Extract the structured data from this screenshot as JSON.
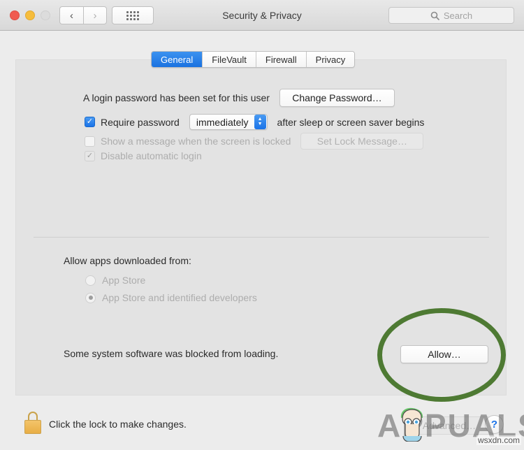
{
  "window": {
    "title": "Security & Privacy",
    "traffic_lights": [
      "close",
      "minimize",
      "zoom"
    ],
    "nav": {
      "back": "‹",
      "forward": "›",
      "grid": "show-all-grid"
    },
    "search": {
      "placeholder": "Search",
      "value": "",
      "icon": "search-icon"
    }
  },
  "tabs": [
    {
      "label": "General",
      "active": true
    },
    {
      "label": "FileVault",
      "active": false
    },
    {
      "label": "Firewall",
      "active": false
    },
    {
      "label": "Privacy",
      "active": false
    }
  ],
  "general": {
    "password_status": "A login password has been set for this user",
    "change_password_button": "Change Password…",
    "require_password": {
      "label": "Require password",
      "checked": true,
      "delay_value": "immediately",
      "suffix": "after sleep or screen saver begins"
    },
    "lock_message": {
      "label": "Show a message when the screen is locked",
      "checked": false,
      "button": "Set Lock Message…",
      "disabled": true
    },
    "disable_auto_login": {
      "label": "Disable automatic login",
      "checked": true,
      "disabled": true
    },
    "allow_apps": {
      "heading": "Allow apps downloaded from:",
      "options": [
        {
          "label": "App Store",
          "selected": false,
          "disabled": true
        },
        {
          "label": "App Store and identified developers",
          "selected": true,
          "disabled": true
        }
      ]
    },
    "blocked_software": {
      "message": "Some system software was blocked from loading.",
      "button": "Allow…"
    }
  },
  "footer": {
    "lock_icon": "lock-closed-icon",
    "lock_text": "Click the lock to make changes.",
    "advanced_button": "Advanced…",
    "help_button": "?"
  },
  "annotation": {
    "shape": "ellipse",
    "color": "#4e7a33",
    "target": "Allow…"
  },
  "watermark": {
    "brand": "APPUALS",
    "url": "wsxdn.com"
  }
}
